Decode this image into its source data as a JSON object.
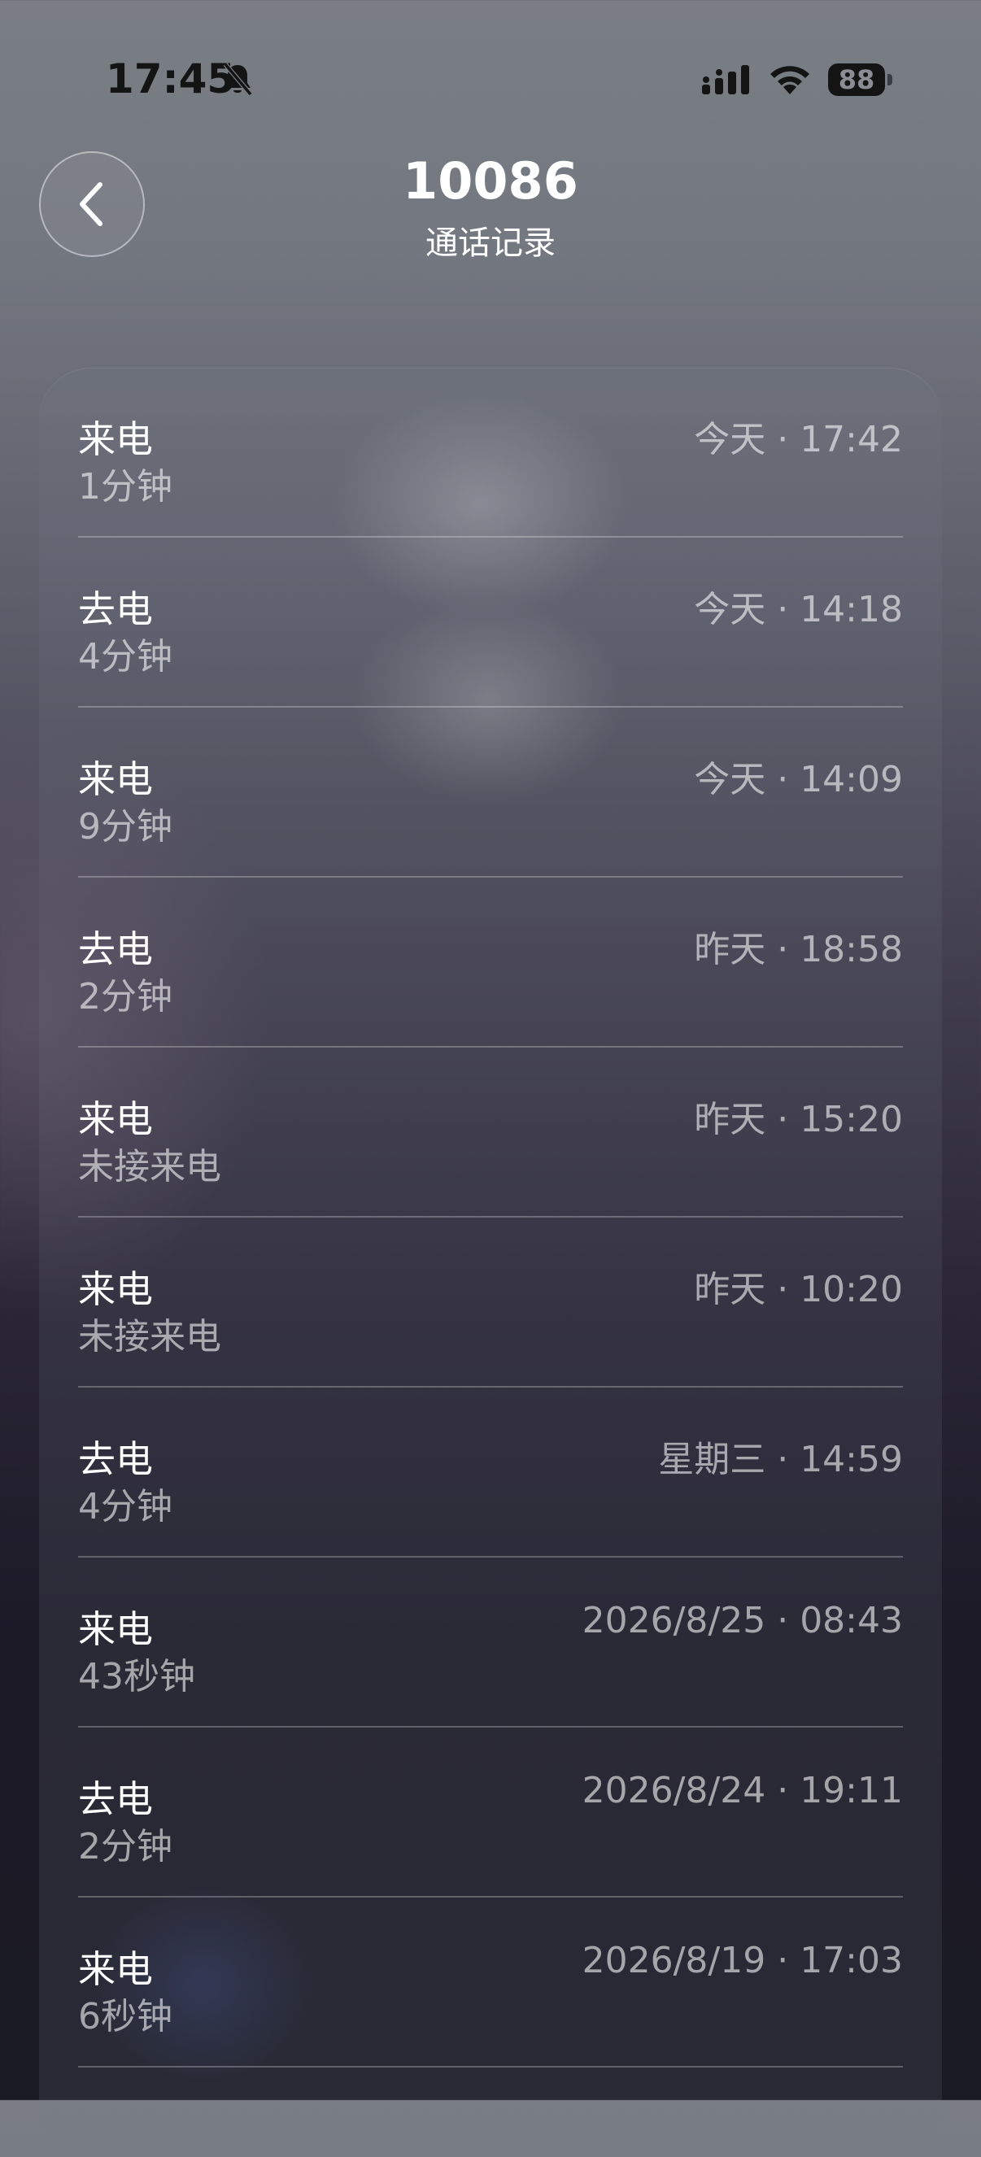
{
  "status_bar": {
    "time": "17:45",
    "battery_level": "88",
    "icons": [
      "bell-slash-icon",
      "cellular-signal-icon",
      "wifi-icon",
      "battery-icon"
    ]
  },
  "header": {
    "back_icon": "chevron-left-icon",
    "title": "10086",
    "subtitle": "通话记录"
  },
  "calls": [
    {
      "type": "来电",
      "duration": "1分钟",
      "time": "今天 · 17:42"
    },
    {
      "type": "去电",
      "duration": "4分钟",
      "time": "今天 · 14:18"
    },
    {
      "type": "来电",
      "duration": "9分钟",
      "time": "今天 · 14:09"
    },
    {
      "type": "去电",
      "duration": "2分钟",
      "time": "昨天 · 18:58"
    },
    {
      "type": "来电",
      "duration": "未接来电",
      "time": "昨天 · 15:20"
    },
    {
      "type": "来电",
      "duration": "未接来电",
      "time": "昨天 · 10:20"
    },
    {
      "type": "去电",
      "duration": "4分钟",
      "time": "星期三 · 14:59"
    },
    {
      "type": "来电",
      "duration": "43秒钟",
      "time": "2026/8/25 · 08:43"
    },
    {
      "type": "去电",
      "duration": "2分钟",
      "time": "2026/8/24 · 19:11"
    },
    {
      "type": "来电",
      "duration": "6秒钟",
      "time": "2026/8/19 · 17:03"
    }
  ]
}
